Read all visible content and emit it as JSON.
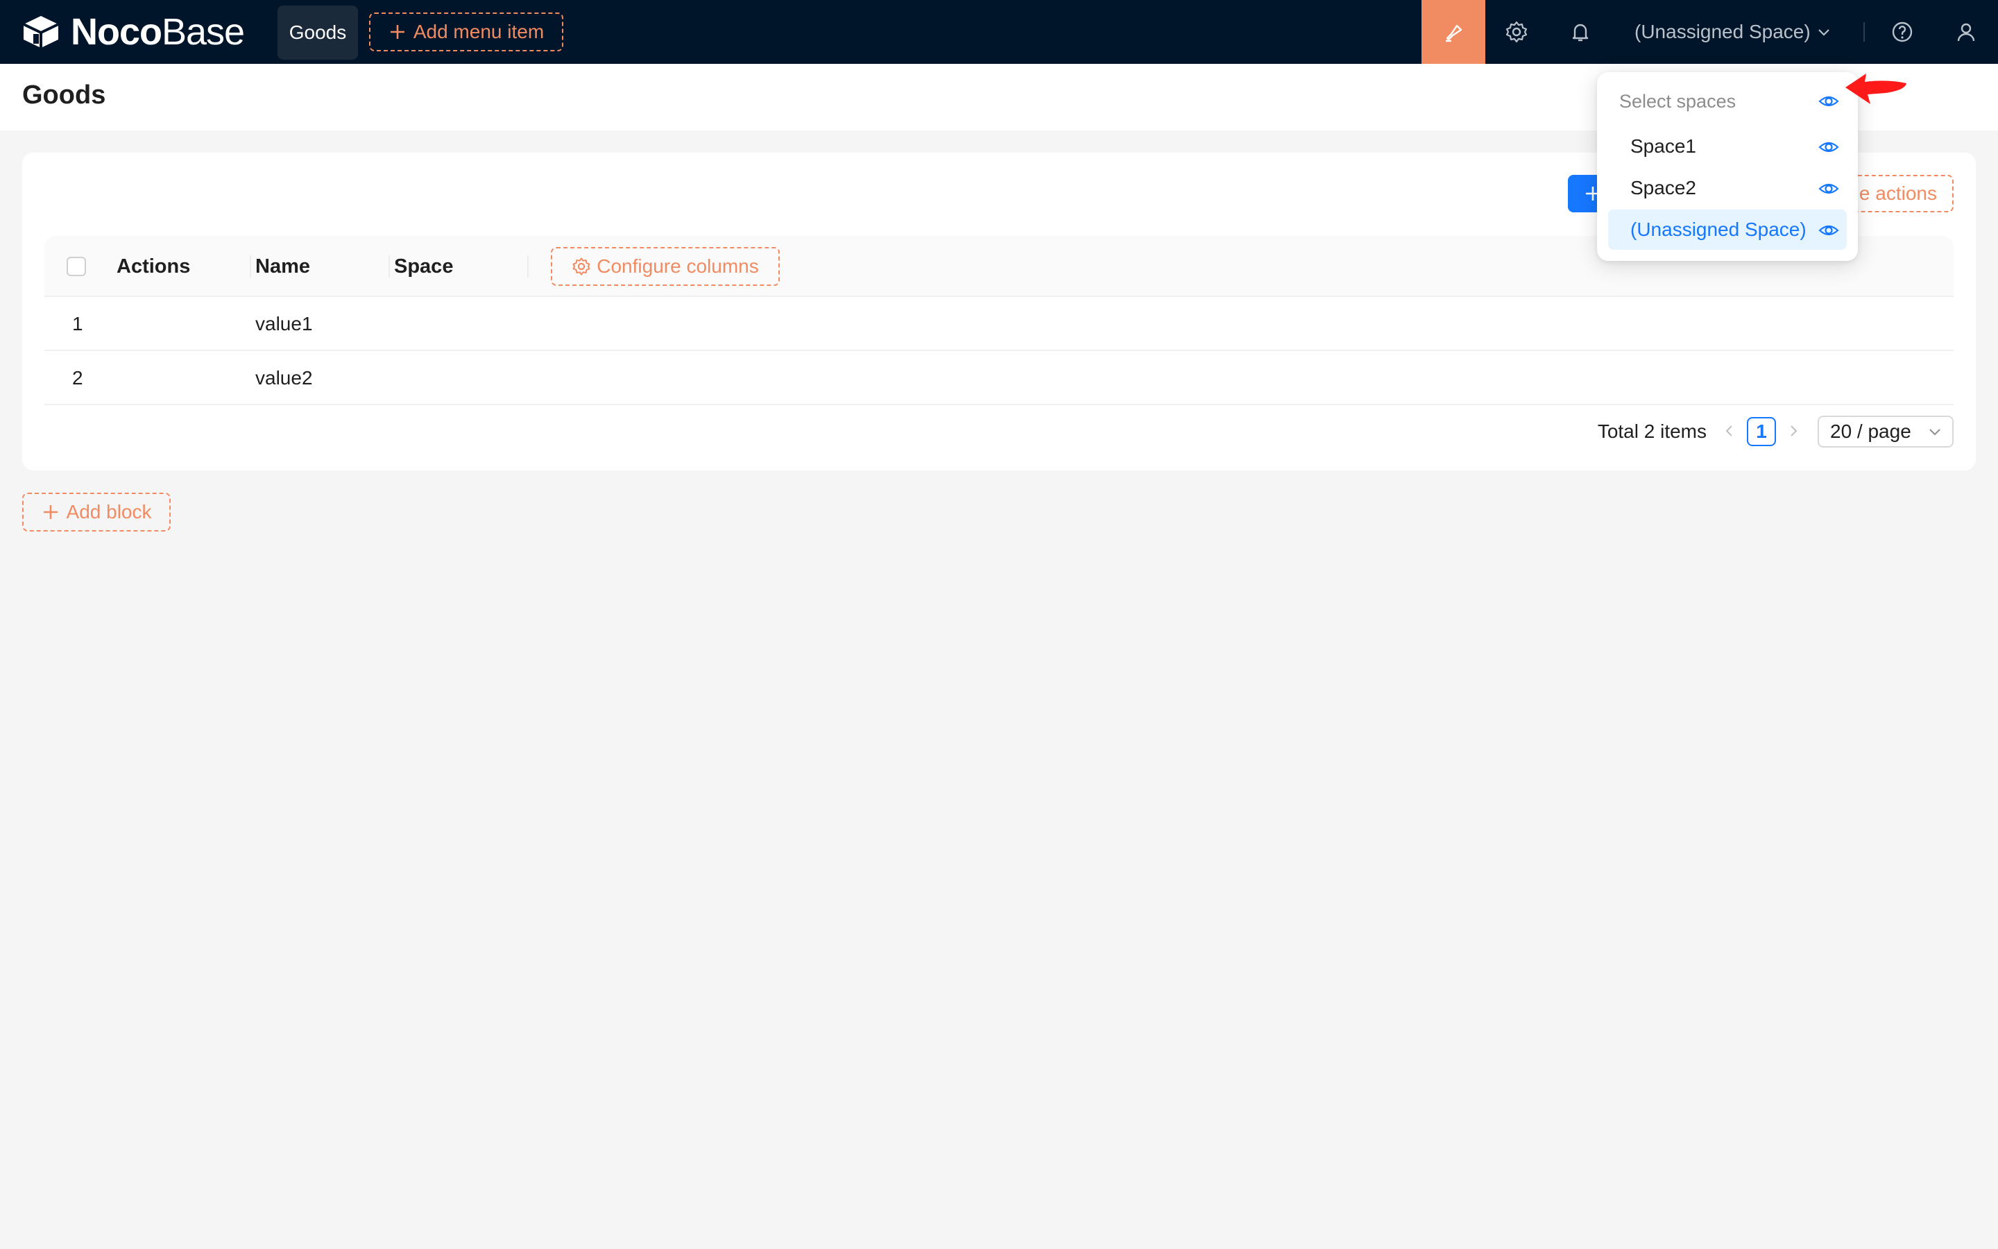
{
  "topbar": {
    "logo_bold": "Noco",
    "logo_light": "Base",
    "menu_active": "Goods",
    "add_menu_item": "Add menu item",
    "space_switch_label": "(Unassigned Space)"
  },
  "page": {
    "title": "Goods"
  },
  "block": {
    "configure_actions_label": "e actions",
    "table": {
      "columns": [
        "Actions",
        "Name",
        "Space"
      ],
      "configure_columns_label": "Configure columns",
      "rows": [
        {
          "index": "1",
          "name": "value1",
          "space": ""
        },
        {
          "index": "2",
          "name": "value2",
          "space": ""
        }
      ]
    },
    "pagination": {
      "total": "Total 2 items",
      "current_page": "1",
      "page_size": "20 / page"
    }
  },
  "add_block_label": "Add block",
  "space_dropdown": {
    "header": "Select spaces",
    "items": [
      "Space1",
      "Space2",
      "(Unassigned Space)"
    ],
    "selected_index": 2
  },
  "colors": {
    "topbar_bg": "#001529",
    "accent_orange": "#f18b62",
    "primary_blue": "#1677ff",
    "annotation_red": "#ff1a1a"
  },
  "icons": {
    "logo": "nocobase-logo-icon",
    "ui_editor": "highlighter-icon",
    "settings": "gear-icon",
    "notifications": "bell-icon",
    "help": "question-circle-icon",
    "user": "user-icon",
    "visibility": "eye-icon",
    "annotation": "red-arrow-pointer"
  }
}
